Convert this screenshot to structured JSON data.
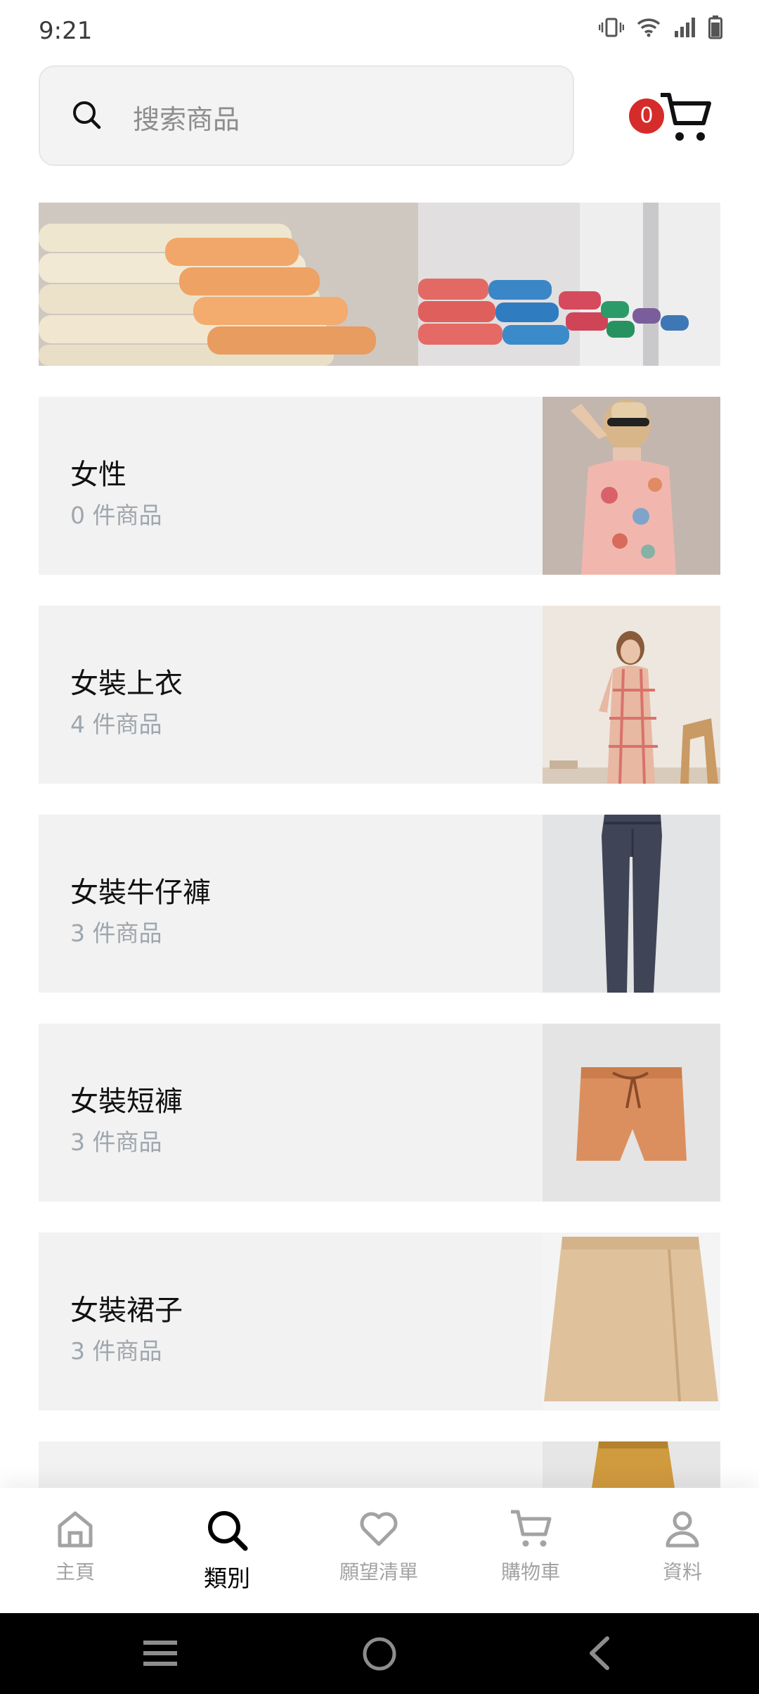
{
  "status": {
    "time": "9:21"
  },
  "search": {
    "placeholder": "搜索商品"
  },
  "cart": {
    "count": "0"
  },
  "categories": [
    {
      "name": "女性",
      "count": "0 件商品"
    },
    {
      "name": "女裝上衣",
      "count": "4 件商品"
    },
    {
      "name": "女裝牛仔褲",
      "count": "3 件商品"
    },
    {
      "name": "女裝短褲",
      "count": "3 件商品"
    },
    {
      "name": "女裝裙子",
      "count": "3 件商品"
    }
  ],
  "nav": [
    {
      "label": "主頁",
      "icon": "home-icon"
    },
    {
      "label": "類別",
      "icon": "search-icon",
      "active": true
    },
    {
      "label": "願望清單",
      "icon": "heart-icon"
    },
    {
      "label": "購物車",
      "icon": "cart-icon"
    },
    {
      "label": "資料",
      "icon": "person-icon"
    }
  ],
  "colors": {
    "badge": "#d52b2b",
    "card": "#f2f2f2",
    "count_text": "#9fa6ad",
    "inactive_nav": "#a3a3a3"
  }
}
